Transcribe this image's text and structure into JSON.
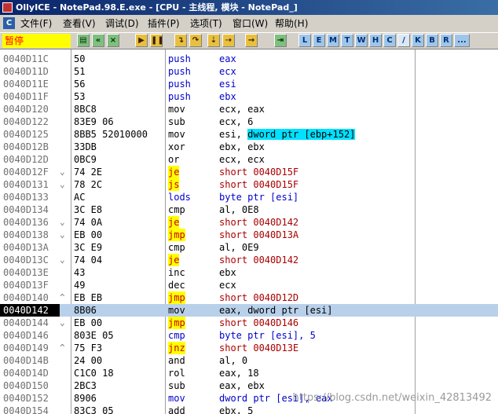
{
  "window": {
    "title": "OllyICE - NotePad.98.E.exe - [CPU - 主线程, 模块 - NotePad_]",
    "icon": "app-icon"
  },
  "menubar": {
    "mdi_icon": "C",
    "items": [
      "文件(F)",
      "查看(V)",
      "调试(D)",
      "插件(P)",
      "选项(T)",
      "窗口(W)",
      "帮助(H)"
    ]
  },
  "toolbar": {
    "status": "暂停",
    "buttons": [
      "open-icon",
      "restart-icon",
      "close-icon",
      "run-icon",
      "pause-icon",
      "step-into-icon",
      "step-over-icon",
      "trace-into-icon",
      "trace-over-icon",
      "execute-till-return-icon",
      "go-to-icon"
    ],
    "letters": [
      "L",
      "E",
      "M",
      "T",
      "W",
      "H",
      "C",
      "/",
      "K",
      "B",
      "R",
      "..."
    ]
  },
  "disasm": [
    {
      "addr": "0040D11C",
      "mark": "",
      "hex": "50",
      "mnem": "push",
      "ops": "eax",
      "kind": "b"
    },
    {
      "addr": "0040D11D",
      "mark": "",
      "hex": "51",
      "mnem": "push",
      "ops": "ecx",
      "kind": "b"
    },
    {
      "addr": "0040D11E",
      "mark": "",
      "hex": "56",
      "mnem": "push",
      "ops": "esi",
      "kind": "b"
    },
    {
      "addr": "0040D11F",
      "mark": "",
      "hex": "53",
      "mnem": "push",
      "ops": "ebx",
      "kind": "b"
    },
    {
      "addr": "0040D120",
      "mark": "",
      "hex": "8BC8",
      "mnem": "mov",
      "ops": "ecx, eax",
      "kind": ""
    },
    {
      "addr": "0040D122",
      "mark": "",
      "hex": "83E9 06",
      "mnem": "sub",
      "ops": "ecx, 6",
      "kind": ""
    },
    {
      "addr": "0040D125",
      "mark": "",
      "hex": "8BB5 52010000",
      "mnem": "mov",
      "ops": "esi, dword ptr [ebp+152]",
      "kind": "hl"
    },
    {
      "addr": "0040D12B",
      "mark": "",
      "hex": "33DB",
      "mnem": "xor",
      "ops": "ebx, ebx",
      "kind": ""
    },
    {
      "addr": "0040D12D",
      "mark": "",
      "hex": "0BC9",
      "mnem": "or",
      "ops": "ecx, ecx",
      "kind": ""
    },
    {
      "addr": "0040D12F",
      "mark": "⌄",
      "hex": "74 2E",
      "mnem": "je",
      "ops": "short 0040D15F",
      "kind": "j"
    },
    {
      "addr": "0040D131",
      "mark": "⌄",
      "hex": "78 2C",
      "mnem": "js",
      "ops": "short 0040D15F",
      "kind": "j"
    },
    {
      "addr": "0040D133",
      "mark": "",
      "hex": "AC",
      "mnem": "lods",
      "ops": "byte ptr [esi]",
      "kind": "bo"
    },
    {
      "addr": "0040D134",
      "mark": "",
      "hex": "3C E8",
      "mnem": "cmp",
      "ops": "al, 0E8",
      "kind": ""
    },
    {
      "addr": "0040D136",
      "mark": "⌄",
      "hex": "74 0A",
      "mnem": "je",
      "ops": "short 0040D142",
      "kind": "j"
    },
    {
      "addr": "0040D138",
      "mark": "⌄",
      "hex": "EB 00",
      "mnem": "jmp",
      "ops": "short 0040D13A",
      "kind": "j"
    },
    {
      "addr": "0040D13A",
      "mark": "",
      "hex": "3C E9",
      "mnem": "cmp",
      "ops": "al, 0E9",
      "kind": ""
    },
    {
      "addr": "0040D13C",
      "mark": "⌄",
      "hex": "74 04",
      "mnem": "je",
      "ops": "short 0040D142",
      "kind": "j"
    },
    {
      "addr": "0040D13E",
      "mark": "",
      "hex": "43",
      "mnem": "inc",
      "ops": "ebx",
      "kind": ""
    },
    {
      "addr": "0040D13F",
      "mark": "",
      "hex": "49",
      "mnem": "dec",
      "ops": "ecx",
      "kind": ""
    },
    {
      "addr": "0040D140",
      "mark": "^",
      "hex": "EB EB",
      "mnem": "jmp",
      "ops": "short 0040D12D",
      "kind": "j"
    },
    {
      "addr": "0040D142",
      "mark": "",
      "hex": "8B06",
      "mnem": "mov",
      "ops": "eax, dword ptr [esi]",
      "kind": "sel"
    },
    {
      "addr": "0040D144",
      "mark": "⌄",
      "hex": "EB 00",
      "mnem": "jmp",
      "ops": "short 0040D146",
      "kind": "j"
    },
    {
      "addr": "0040D146",
      "mark": "",
      "hex": "803E 05",
      "mnem": "cmp",
      "ops": "byte ptr [esi], 5",
      "kind": "bo"
    },
    {
      "addr": "0040D149",
      "mark": "^",
      "hex": "75 F3",
      "mnem": "jnz",
      "ops": "short 0040D13E",
      "kind": "j"
    },
    {
      "addr": "0040D14B",
      "mark": "",
      "hex": "24 00",
      "mnem": "and",
      "ops": "al, 0",
      "kind": ""
    },
    {
      "addr": "0040D14D",
      "mark": "",
      "hex": "C1C0 18",
      "mnem": "rol",
      "ops": "eax, 18",
      "kind": ""
    },
    {
      "addr": "0040D150",
      "mark": "",
      "hex": "2BC3",
      "mnem": "sub",
      "ops": "eax, ebx",
      "kind": ""
    },
    {
      "addr": "0040D152",
      "mark": "",
      "hex": "8906",
      "mnem": "mov",
      "ops": "dword ptr [esi], eax",
      "kind": "bo"
    },
    {
      "addr": "0040D154",
      "mark": "",
      "hex": "83C3 05",
      "mnem": "add",
      "ops": "ebx, 5",
      "kind": ""
    }
  ],
  "watermark": "https://blog.csdn.net/weixin_42813492"
}
